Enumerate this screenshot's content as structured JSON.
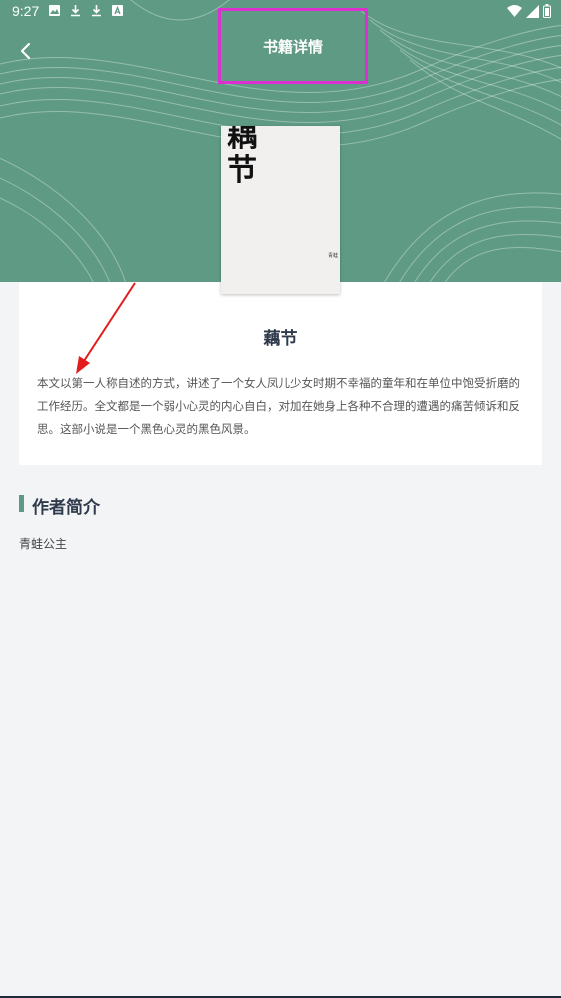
{
  "status_bar": {
    "time": "9:27"
  },
  "header": {
    "title": "书籍详情",
    "background_color": "#5e9a84"
  },
  "book": {
    "cover_title": "耦节",
    "cover_author": "青蛙",
    "name": "藕节",
    "description": "本文以第一人称自述的方式，讲述了一个女人凤儿少女时期不幸福的童年和在单位中饱受折磨的工作经历。全文都是一个弱小心灵的内心自白，对加在她身上各种不合理的遭遇的痛苦倾诉和反思。这部小说是一个黑色心灵的黑色风景。"
  },
  "author_section": {
    "title": "作者简介",
    "content": "青蛙公主"
  },
  "annotations": {
    "highlight_color": "#dd2fd0",
    "arrow_color": "#e11d1d"
  }
}
